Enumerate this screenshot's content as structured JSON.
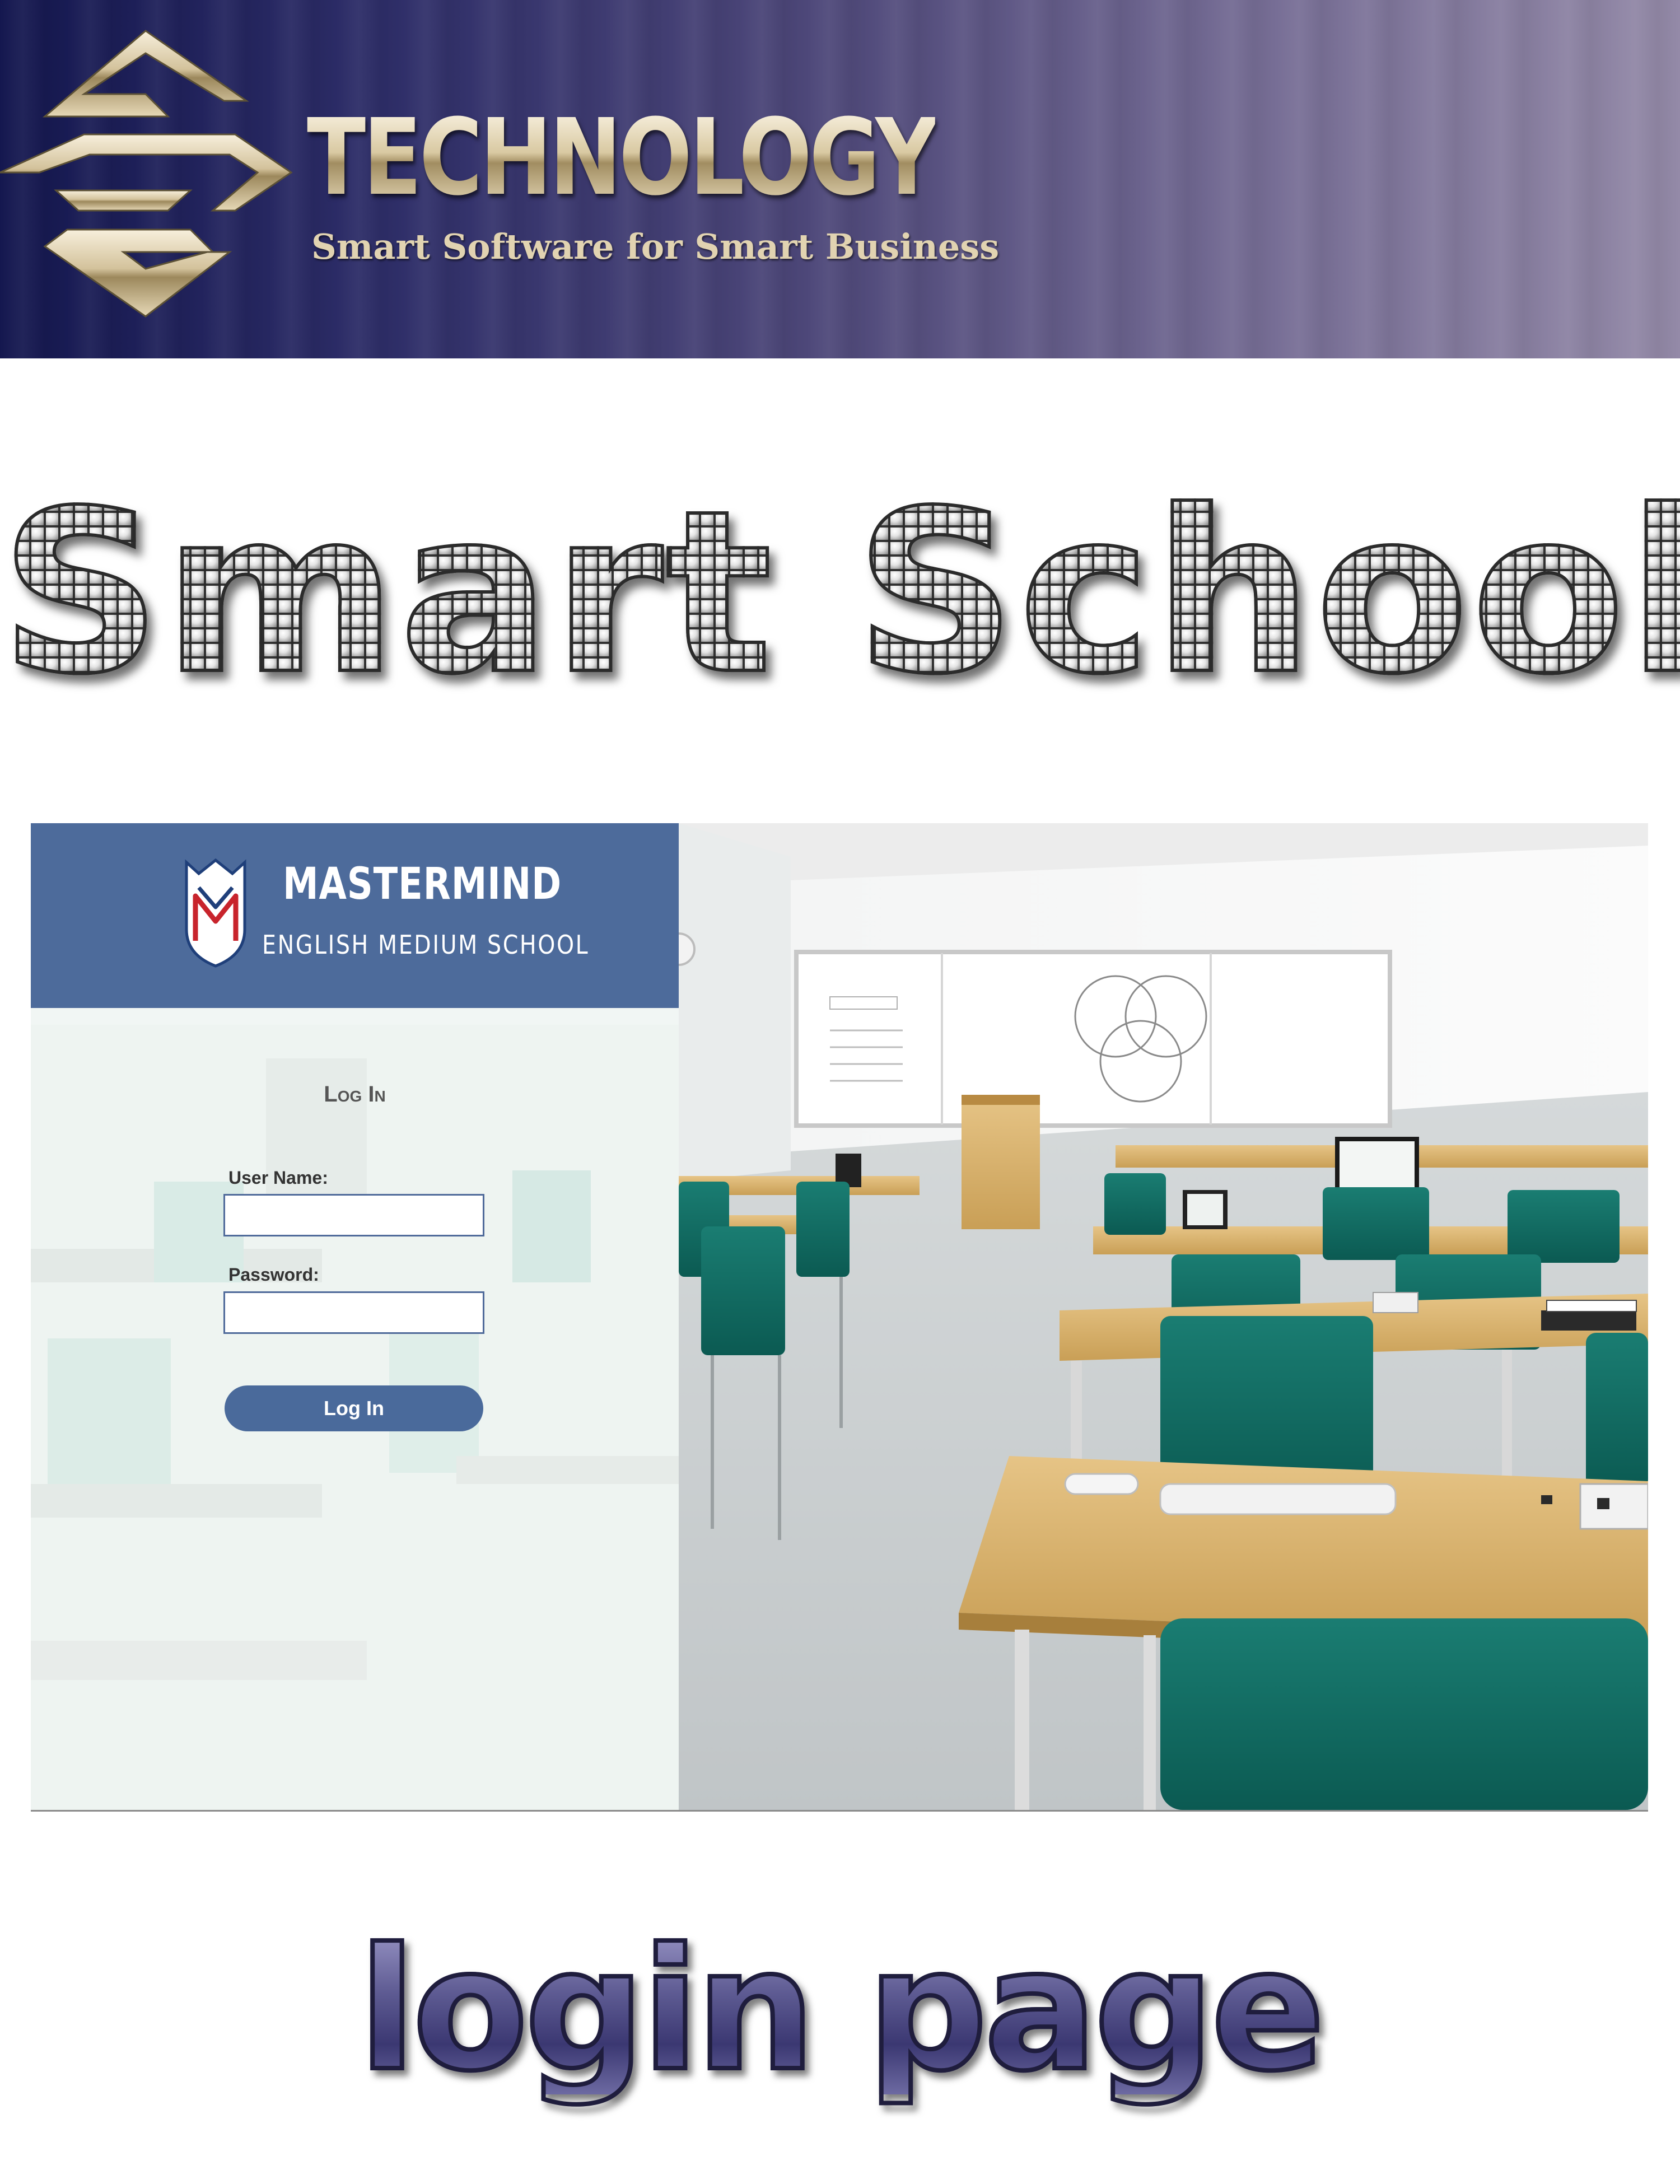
{
  "colors": {
    "banner_start": "#14174f",
    "banner_end": "#948aa8",
    "gold": "#d6c8a8",
    "school_blue": "#4d6b9b",
    "button_blue": "#4a6a9b",
    "chair_teal": "#0f6e63",
    "desk_wood": "#d9b56f",
    "caption_purple": "#54508a"
  },
  "banner": {
    "logo_icon": "stacked-s-diamond-logo",
    "brand_name": "TECHNOLOGY",
    "tagline": "Smart Software for Smart Business"
  },
  "hero": {
    "title": "Smart School"
  },
  "login_screen": {
    "school": {
      "crest_icon": "school-crest-icon",
      "name": "MASTERMIND",
      "subtitle": "ENGLISH MEDIUM SCHOOL"
    },
    "heading": "Log In",
    "username_label": "User Name:",
    "username_value": "",
    "password_label": "Password:",
    "password_value": "",
    "submit_label": "Log In",
    "background_image": "classroom-photo"
  },
  "caption": {
    "text": "login page"
  }
}
